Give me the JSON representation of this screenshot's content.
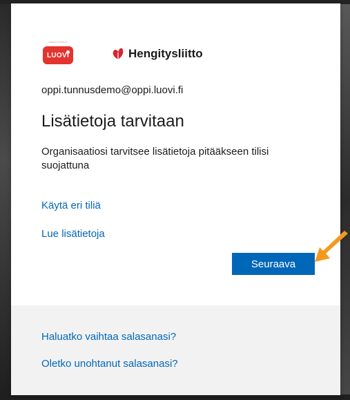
{
  "logos": {
    "luovi_small_text": "AMMATTIOPISTO",
    "luovi_text": "LUOVI",
    "hengitysliitto_text": "Hengitysliitto"
  },
  "account": {
    "email": "oppi.tunnusdemo@oppi.luovi.fi"
  },
  "main": {
    "title": "Lisätietoja tarvitaan",
    "description": "Organisaatiosi tarvitsee lisätietoja pitääkseen tilisi suojattuna",
    "links": {
      "other_account": "Käytä eri tiliä",
      "learn_more": "Lue lisätietoja"
    },
    "next_button": "Seuraava"
  },
  "footer": {
    "change_password": "Haluatko vaihtaa salasanasi?",
    "forgot_password": "Oletko unohtanut salasanasi?"
  },
  "colors": {
    "primary": "#0067b8",
    "link": "#0067b8",
    "luovi_red": "#e3342f",
    "hengitysliitto_red": "#d9232e",
    "arrow_orange": "#f39a1e",
    "footer_bg": "#f2f2f2"
  }
}
